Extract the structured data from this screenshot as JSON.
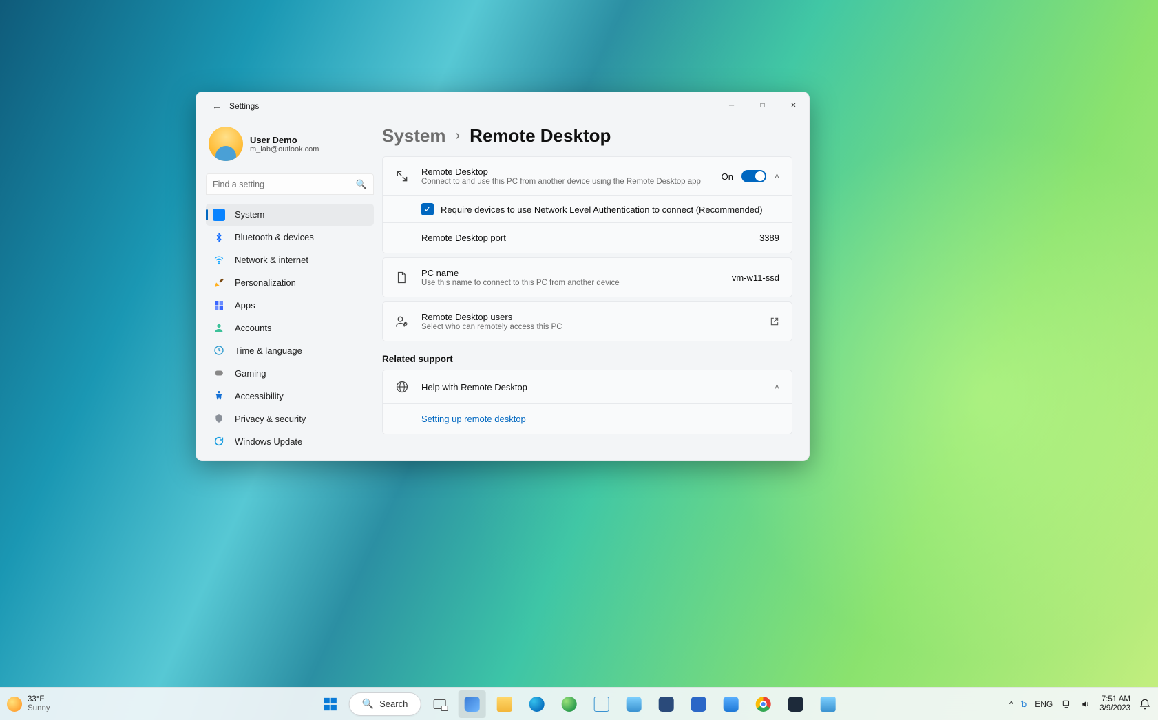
{
  "window": {
    "app_title": "Settings"
  },
  "profile": {
    "name": "User Demo",
    "email": "m_lab@outlook.com"
  },
  "search": {
    "placeholder": "Find a setting"
  },
  "sidebar": {
    "items": [
      {
        "label": "System",
        "icon": "sys",
        "selected": true
      },
      {
        "label": "Bluetooth & devices",
        "icon": "bt"
      },
      {
        "label": "Network & internet",
        "icon": "net"
      },
      {
        "label": "Personalization",
        "icon": "pers"
      },
      {
        "label": "Apps",
        "icon": "apps"
      },
      {
        "label": "Accounts",
        "icon": "acct"
      },
      {
        "label": "Time & language",
        "icon": "time"
      },
      {
        "label": "Gaming",
        "icon": "game"
      },
      {
        "label": "Accessibility",
        "icon": "acc"
      },
      {
        "label": "Privacy & security",
        "icon": "priv"
      },
      {
        "label": "Windows Update",
        "icon": "upd"
      }
    ]
  },
  "breadcrumb": {
    "parent": "System",
    "current": "Remote Desktop"
  },
  "rdp": {
    "title": "Remote Desktop",
    "desc": "Connect to and use this PC from another device using the Remote Desktop app",
    "toggle_state": "On",
    "nla_label": "Require devices to use Network Level Authentication to connect (Recommended)",
    "nla_checked": true,
    "port_label": "Remote Desktop port",
    "port_value": "3389"
  },
  "pcname": {
    "title": "PC name",
    "desc": "Use this name to connect to this PC from another device",
    "value": "vm-w11-ssd"
  },
  "rdpusers": {
    "title": "Remote Desktop users",
    "desc": "Select who can remotely access this PC"
  },
  "support": {
    "section": "Related support",
    "help_title": "Help with Remote Desktop",
    "link": "Setting up remote desktop"
  },
  "taskbar": {
    "weather_temp": "33°F",
    "weather_desc": "Sunny",
    "search_label": "Search",
    "lang": "ENG",
    "time": "7:51 AM",
    "date": "3/9/2023"
  }
}
